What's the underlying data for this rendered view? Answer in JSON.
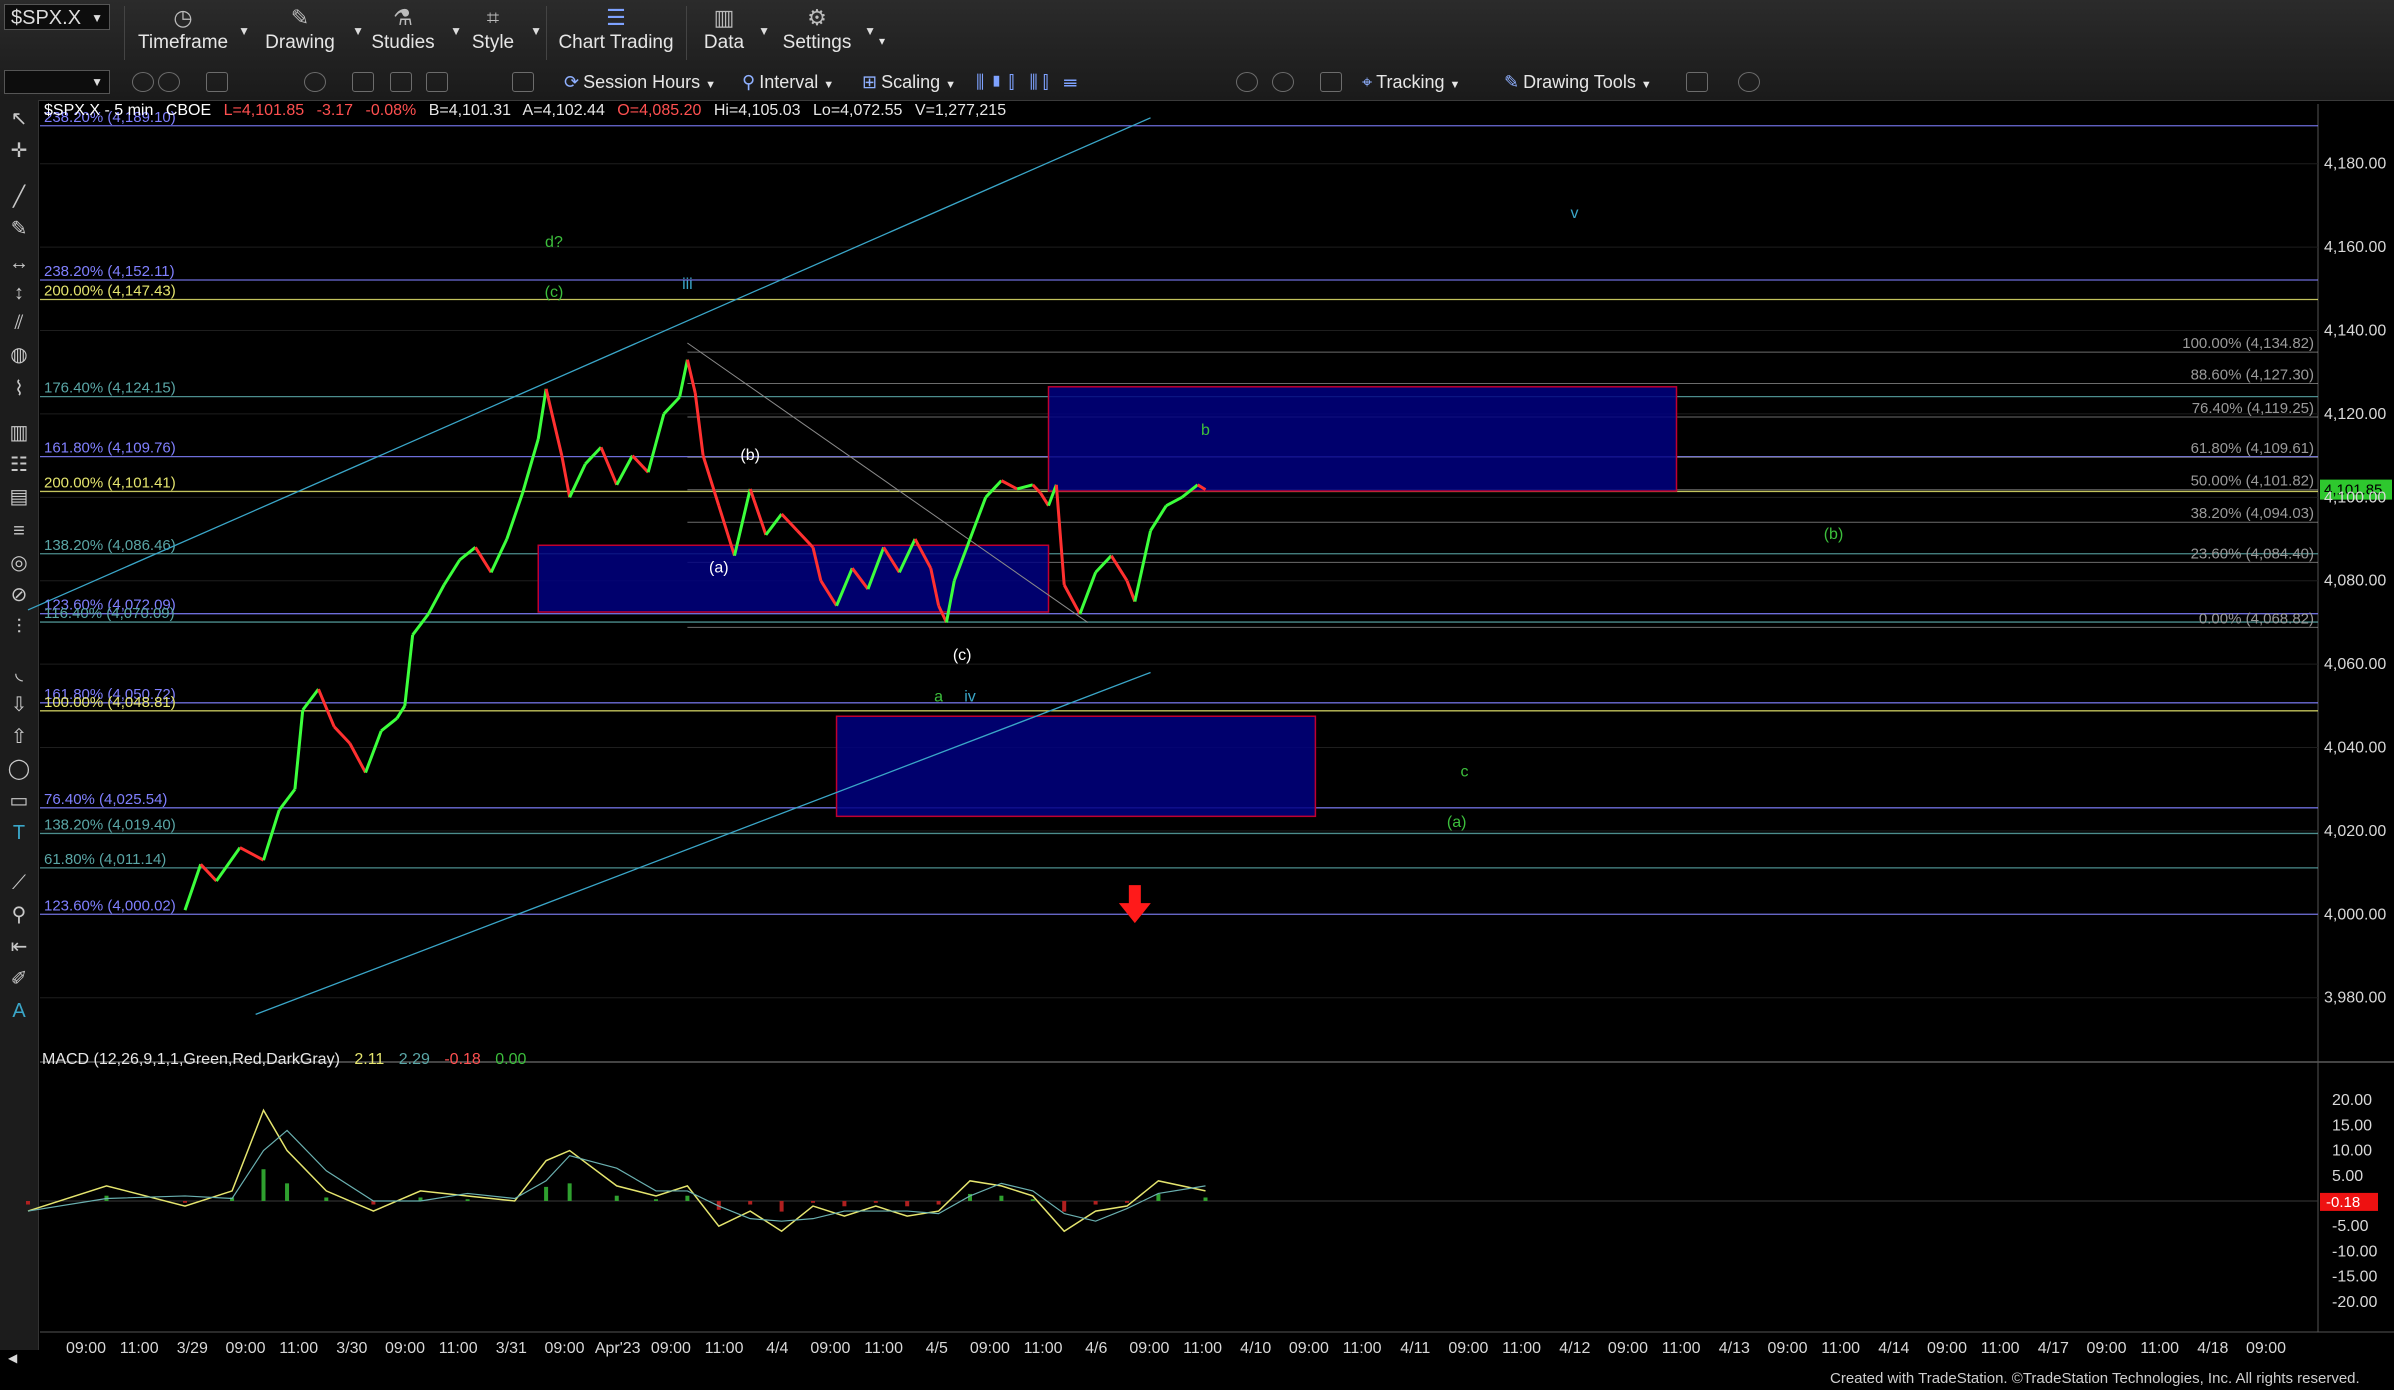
{
  "toolbar": {
    "symbol": "$SPX.X",
    "items": [
      "Timeframe",
      "Drawing",
      "Studies",
      "Style",
      "Chart Trading",
      "Data",
      "Settings"
    ],
    "row2": {
      "session": "Session Hours",
      "interval": "Interval",
      "scaling": "Scaling",
      "tracking": "Tracking",
      "drawing_tools": "Drawing Tools"
    }
  },
  "header": {
    "symbol": "$SPX.X - 5 min",
    "exchange": "CBOE",
    "last": "L=4,101.85",
    "chg": "-3.17",
    "pct": "-0.08%",
    "bid": "B=4,101.31",
    "ask": "A=4,102.44",
    "open": "O=4,085.20",
    "high": "Hi=4,105.03",
    "low": "Lo=4,072.55",
    "vol": "V=1,277,215"
  },
  "macd_header": {
    "label": "MACD (12,26,9,1,1,Green,Red,DarkGray)",
    "v1": "2.11",
    "v2": "2.29",
    "v3": "-0.18",
    "v4": "0.00"
  },
  "footer": "Created with TradeStation. ©TradeStation Technologies, Inc. All rights reserved.",
  "colors": {
    "up": "#3cff3c",
    "down": "#ff3030",
    "fib_yellow": "#e5e56e",
    "fib_blue": "#8080ff",
    "fib_teal": "#5aa6a6",
    "fib_gray": "#9a9a9a",
    "zone_fill": "#000080",
    "zone_border": "#c00030",
    "trend": "#3aa6c8"
  },
  "chart_data": {
    "type": "candlestick",
    "price_axis": {
      "ylim": [
        3970,
        4190
      ],
      "ticks": [
        "4,180.00",
        "4,160.00",
        "4,140.00",
        "4,120.00",
        "4,100.00",
        "4,080.00",
        "4,060.00",
        "4,040.00",
        "4,020.00",
        "4,000.00",
        "3,980.00"
      ],
      "current_label": "4,101.85"
    },
    "macd_axis": {
      "ylim": [
        -24,
        24
      ],
      "ticks": [
        "20.00",
        "15.00",
        "10.00",
        "5.00",
        "-5.00",
        "-10.00",
        "-15.00",
        "-20.00"
      ],
      "current_label": "-0.18"
    },
    "time_labels": [
      "09:00",
      "11:00",
      "3/29",
      "09:00",
      "11:00",
      "3/30",
      "09:00",
      "11:00",
      "3/31",
      "09:00",
      "Apr'23",
      "09:00",
      "11:00",
      "4/4",
      "09:00",
      "11:00",
      "4/5",
      "09:00",
      "11:00",
      "4/6",
      "09:00",
      "11:00",
      "4/10",
      "09:00",
      "11:00",
      "4/11",
      "09:00",
      "11:00",
      "4/12",
      "09:00",
      "11:00",
      "4/13",
      "09:00",
      "11:00",
      "4/14",
      "09:00",
      "11:00",
      "4/17",
      "09:00",
      "11:00",
      "4/18",
      "09:00"
    ],
    "price_path": [
      [
        0,
        4001
      ],
      [
        2,
        4012
      ],
      [
        4,
        4008
      ],
      [
        7,
        4016
      ],
      [
        10,
        4013
      ],
      [
        12,
        4025
      ],
      [
        14,
        4030
      ],
      [
        15,
        4049
      ],
      [
        17,
        4054
      ],
      [
        19,
        4045
      ],
      [
        21,
        4041
      ],
      [
        23,
        4034
      ],
      [
        25,
        4044
      ],
      [
        27,
        4047
      ],
      [
        28,
        4050
      ],
      [
        29,
        4067
      ],
      [
        31,
        4072
      ],
      [
        33,
        4079
      ],
      [
        35,
        4085
      ],
      [
        37,
        4088
      ],
      [
        39,
        4082
      ],
      [
        41,
        4090
      ],
      [
        43,
        4101
      ],
      [
        45,
        4114
      ],
      [
        46,
        4126
      ],
      [
        48,
        4110
      ],
      [
        49,
        4100
      ],
      [
        51,
        4108
      ],
      [
        53,
        4112
      ],
      [
        55,
        4103
      ],
      [
        57,
        4110
      ],
      [
        59,
        4106
      ],
      [
        61,
        4120
      ],
      [
        63,
        4124
      ],
      [
        64,
        4133
      ],
      [
        65,
        4125
      ],
      [
        66,
        4110
      ],
      [
        68,
        4098
      ],
      [
        70,
        4086
      ],
      [
        72,
        4102
      ],
      [
        74,
        4091
      ],
      [
        76,
        4096
      ],
      [
        78,
        4092
      ],
      [
        80,
        4088
      ],
      [
        81,
        4080
      ],
      [
        83,
        4074
      ],
      [
        85,
        4083
      ],
      [
        87,
        4078
      ],
      [
        89,
        4088
      ],
      [
        91,
        4082
      ],
      [
        93,
        4090
      ],
      [
        95,
        4083
      ],
      [
        96,
        4074
      ],
      [
        97,
        4070
      ],
      [
        98,
        4080
      ],
      [
        100,
        4090
      ],
      [
        102,
        4100
      ],
      [
        104,
        4104
      ],
      [
        106,
        4102
      ],
      [
        108,
        4103
      ],
      [
        109,
        4101
      ],
      [
        110,
        4098
      ],
      [
        111,
        4103
      ],
      [
        112,
        4079
      ],
      [
        114,
        4072
      ],
      [
        116,
        4082
      ],
      [
        118,
        4086
      ],
      [
        120,
        4080
      ],
      [
        121,
        4075
      ],
      [
        123,
        4092
      ],
      [
        125,
        4098
      ],
      [
        127,
        4100
      ],
      [
        129,
        4103
      ],
      [
        130,
        4101.85
      ]
    ],
    "fib_levels_left": [
      {
        "label": "238.20% (4,189.10)",
        "price": 4189.1,
        "color": "blue"
      },
      {
        "label": "238.20% (4,152.11)",
        "price": 4152.11,
        "color": "blue"
      },
      {
        "label": "200.00% (4,147.43)",
        "price": 4147.43,
        "color": "yellow"
      },
      {
        "label": "176.40% (4,124.15)",
        "price": 4124.15,
        "color": "teal"
      },
      {
        "label": "161.80% (4,109.76)",
        "price": 4109.76,
        "color": "blue"
      },
      {
        "label": "200.00% (4,101.41)",
        "price": 4101.41,
        "color": "yellow"
      },
      {
        "label": "138.20% (4,086.46)",
        "price": 4086.46,
        "color": "teal"
      },
      {
        "label": "123.60% (4,072.09)",
        "price": 4072.09,
        "color": "blue"
      },
      {
        "label": "116.40% (4,070.09)",
        "price": 4070.09,
        "color": "teal"
      },
      {
        "label": "161.80% (4,050.72)",
        "price": 4050.72,
        "color": "blue"
      },
      {
        "label": "100.00% (4,048.81)",
        "price": 4048.81,
        "color": "yellow"
      },
      {
        "label": "76.40% (4,025.54)",
        "price": 4025.54,
        "color": "blue"
      },
      {
        "label": "138.20% (4,019.40)",
        "price": 4019.4,
        "color": "teal"
      },
      {
        "label": "61.80% (4,011.14)",
        "price": 4011.14,
        "color": "teal"
      },
      {
        "label": "123.60% (4,000.02)",
        "price": 4000.02,
        "color": "blue"
      }
    ],
    "fib_levels_right": [
      {
        "label": "100.00% (4,134.82)",
        "price": 4134.82
      },
      {
        "label": "88.60% (4,127.30)",
        "price": 4127.3
      },
      {
        "label": "76.40% (4,119.25)",
        "price": 4119.25
      },
      {
        "label": "61.80% (4,109.61)",
        "price": 4109.61
      },
      {
        "label": "50.00% (4,101.82)",
        "price": 4101.82
      },
      {
        "label": "38.20% (4,094.03)",
        "price": 4094.03
      },
      {
        "label": "23.60% (4,084.40)",
        "price": 4084.4
      },
      {
        "label": "0.00% (4,068.82)",
        "price": 4068.82
      }
    ],
    "zones": [
      {
        "name": "upper-target-zone",
        "t0": 110,
        "t1": 190,
        "p_top": 4126.5,
        "p_bot": 4101.5
      },
      {
        "name": "middle-support-zone",
        "t0": 45,
        "t1": 110,
        "p_top": 4088.5,
        "p_bot": 4072.5
      },
      {
        "name": "lower-target-zone",
        "t0": 83,
        "t1": 144,
        "p_top": 4047.5,
        "p_bot": 4023.5
      }
    ],
    "wave_labels": [
      {
        "text": "d?",
        "t": 47,
        "p": 4160,
        "color": "green"
      },
      {
        "text": "(c)",
        "t": 47,
        "p": 4148,
        "color": "green"
      },
      {
        "text": "iii",
        "t": 64,
        "p": 4150,
        "color": "teal"
      },
      {
        "text": "(b)",
        "t": 72,
        "p": 4109,
        "color": "white"
      },
      {
        "text": "(a)",
        "t": 68,
        "p": 4082,
        "color": "white"
      },
      {
        "text": "(c)",
        "t": 99,
        "p": 4061,
        "color": "white"
      },
      {
        "text": "a",
        "t": 96,
        "p": 4051,
        "color": "green"
      },
      {
        "text": "iv",
        "t": 100,
        "p": 4051,
        "color": "teal"
      },
      {
        "text": "b",
        "t": 130,
        "p": 4115,
        "color": "green"
      },
      {
        "text": "v",
        "t": 177,
        "p": 4167,
        "color": "teal"
      },
      {
        "text": "(b)",
        "t": 210,
        "p": 4090,
        "color": "green"
      },
      {
        "text": "c",
        "t": 163,
        "p": 4033,
        "color": "green"
      },
      {
        "text": "(a)",
        "t": 162,
        "p": 4021,
        "color": "green"
      }
    ]
  }
}
